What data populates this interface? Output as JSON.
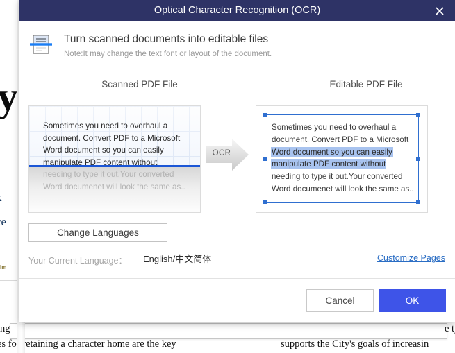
{
  "dialog": {
    "title": "Optical Character Recognition (OCR)",
    "close_icon": "close-icon",
    "header": {
      "icon": "scanner-icon",
      "title": "Turn scanned documents into editable files",
      "note": "Note:It may change the text font or layout of the document."
    },
    "panels": {
      "left_label": "Scanned PDF File",
      "right_label": "Editable PDF File",
      "arrow_label": "OCR",
      "scanned_text_lines": [
        "Sometimes you need to overhaul a",
        "document. Convert PDF to a Microsoft",
        "Word document so you can easily",
        "manipulate PDF content without",
        "needing to type it out.Your converted",
        "Word documenet will look the same as.."
      ],
      "editable_text_lines": [
        {
          "text": "Sometimes you need to overhaul a",
          "highlighted": false
        },
        {
          "text": "document. Convert PDF to a Microsoft",
          "highlighted": false
        },
        {
          "text": "Word document so you can easily",
          "highlighted": true
        },
        {
          "text": "manipulate PDF content without",
          "highlighted": true
        },
        {
          "text": "needing to type it out.Your converted",
          "highlighted": false
        },
        {
          "text": "Word documenet will look the same as..",
          "highlighted": false
        }
      ]
    },
    "controls": {
      "change_languages_label": "Change Languages",
      "current_language_label": "Your Current Language：",
      "current_language_value": "English/中文简体",
      "customize_pages_label": "Customize Pages"
    },
    "footer": {
      "cancel_label": "Cancel",
      "ok_label": "OK"
    },
    "colors": {
      "titlebar": "#2e3366",
      "ok_button": "#3e54e8",
      "scan_line": "#1b56d6",
      "selection_highlight": "#a8c3ef",
      "selection_border": "#2f6fd0",
      "link": "#2a6dc4"
    }
  },
  "background_document": {
    "big_fragment": "yg",
    "mid_fragment_1": "k",
    "mid_fragment_2": "ce",
    "tiny_fragment": "Im",
    "partial_left_top": "ing",
    "partial_right_top": "e ty",
    "row_left_text": "es for retaining a character home are the key",
    "row_right_text": "supports the City's goals of increasin"
  }
}
